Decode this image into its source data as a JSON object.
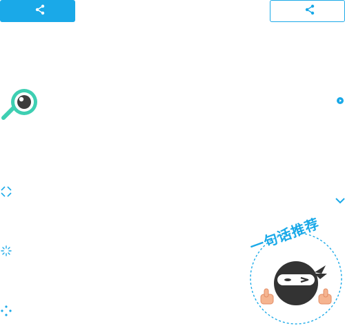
{
  "share": {
    "left": {
      "label": "",
      "icon": "share-icon"
    },
    "right": {
      "label": "",
      "icon": "share-icon"
    }
  },
  "logo": {
    "icon": "magnifier-eye-icon"
  },
  "icons": {
    "play": "play-icon",
    "expand": "expand-icon",
    "chevron": "chevron-down-icon",
    "spinner": "loading-spinner-icon"
  },
  "badge": {
    "text": "一句话推荐",
    "mascot": "ninja-mascot"
  },
  "colors": {
    "accent": "#1aa9e8",
    "logo_teal": "#3ecfb2",
    "ninja": "#333333",
    "skin": "#f5b490"
  }
}
